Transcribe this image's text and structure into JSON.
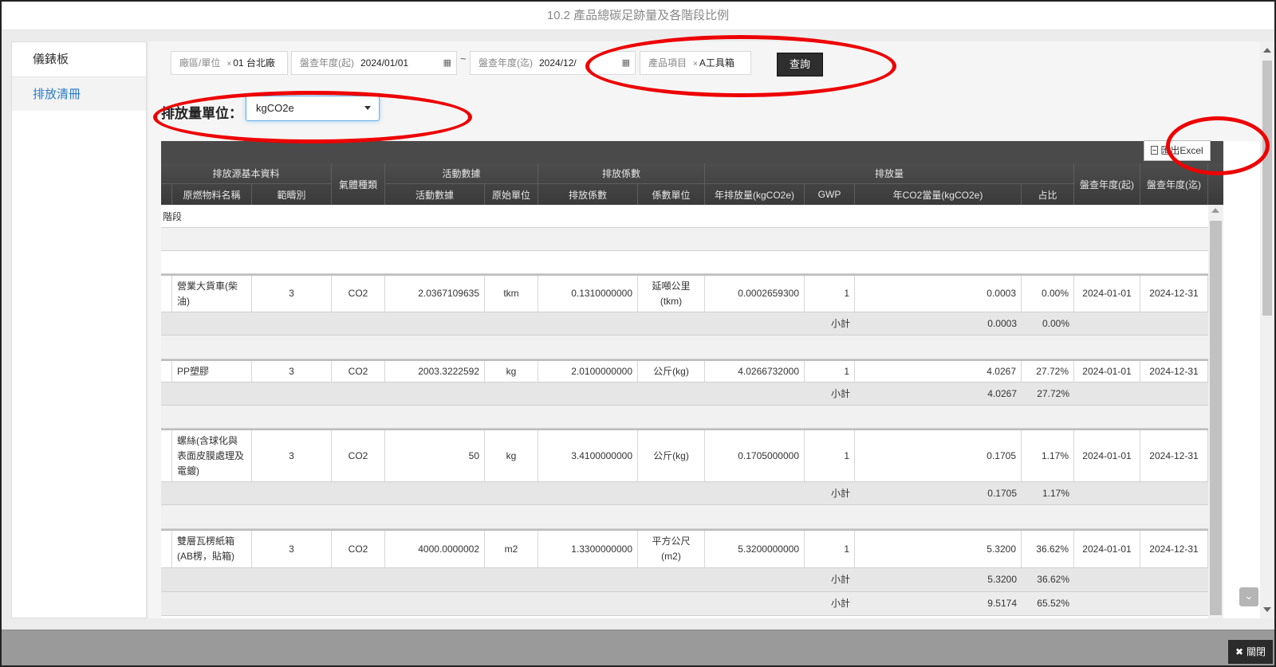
{
  "modal": {
    "title": "10.2 產品總碳足跡量及各階段比例"
  },
  "sidebar": {
    "items": [
      {
        "label": "儀錶板"
      },
      {
        "label": "排放清冊"
      }
    ]
  },
  "filters": {
    "site_label": "廠區/單位",
    "site_value": "01 台北廠",
    "start_label": "盤查年度(起)",
    "start_value": "2024/01/01",
    "tilde": "~",
    "end_label": "盤查年度(迄)",
    "end_value": "2024/12/",
    "product_label": "產品項目",
    "product_value": "A工具箱",
    "remove_x": "×",
    "query_button": "查詢"
  },
  "unit": {
    "label": "排放量單位：",
    "value": "kgCO2e"
  },
  "export_button": "匯出Excel",
  "table": {
    "group_headers": {
      "source_basic": "排放源基本資料",
      "gas_type": "氣體種類",
      "activity_data": "活動數據",
      "emission_factor": "排放係數",
      "emissions": "排放量",
      "year_start": "盤查年度(起)",
      "year_end": "盤查年度(迄)"
    },
    "sub_headers": {
      "material_name": "原燃物料名稱",
      "scope": "範疇別",
      "activity": "活動數據",
      "raw_unit": "原始單位",
      "factor": "排放係數",
      "factor_unit": "係數單位",
      "annual_emission": "年排放量(kgCO2e)",
      "gwp": "GWP",
      "co2e": "年CO2當量(kgCO2e)",
      "ratio": "占比"
    },
    "stage_label": "階段",
    "subtotal_label": "小計",
    "rows": [
      {
        "name": "營業大貨車(柴油)",
        "scope": "3",
        "gas": "CO2",
        "activity": "2.0367109635",
        "unit": "tkm",
        "factor": "0.1310000000",
        "factor_unit": "延噸公里(tkm)",
        "annual": "0.0002659300",
        "gwp": "1",
        "co2e": "0.0003",
        "ratio": "0.00%",
        "start": "2024-01-01",
        "end": "2024-12-31",
        "sub_co2e": "0.0003",
        "sub_ratio": "0.00%"
      },
      {
        "name": "PP塑膠",
        "scope": "3",
        "gas": "CO2",
        "activity": "2003.3222592",
        "unit": "kg",
        "factor": "2.0100000000",
        "factor_unit": "公斤(kg)",
        "annual": "4.0266732000",
        "gwp": "1",
        "co2e": "4.0267",
        "ratio": "27.72%",
        "start": "2024-01-01",
        "end": "2024-12-31",
        "sub_co2e": "4.0267",
        "sub_ratio": "27.72%"
      },
      {
        "name": "螺絲(含球化與表面皮膜處理及電鍍)",
        "scope": "3",
        "gas": "CO2",
        "activity": "50",
        "unit": "kg",
        "factor": "3.4100000000",
        "factor_unit": "公斤(kg)",
        "annual": "0.1705000000",
        "gwp": "1",
        "co2e": "0.1705",
        "ratio": "1.17%",
        "start": "2024-01-01",
        "end": "2024-12-31",
        "sub_co2e": "0.1705",
        "sub_ratio": "1.17%"
      },
      {
        "name": "雙層瓦楞紙箱(AB楞，貼箱)",
        "scope": "3",
        "gas": "CO2",
        "activity": "4000.0000002",
        "unit": "m2",
        "factor": "1.3300000000",
        "factor_unit": "平方公尺(m2)",
        "annual": "5.3200000000",
        "gwp": "1",
        "co2e": "5.3200",
        "ratio": "36.62%",
        "start": "2024-01-01",
        "end": "2024-12-31",
        "sub_co2e": "5.3200",
        "sub_ratio": "36.62%"
      }
    ],
    "group_total": {
      "co2e": "9.5174",
      "ratio": "65.52%"
    }
  },
  "footer": {
    "close_button": "關閉"
  },
  "colors": {
    "annotation_ring": "#ee0000",
    "header_bg": "#444444",
    "active_link": "#2a7ac7"
  }
}
